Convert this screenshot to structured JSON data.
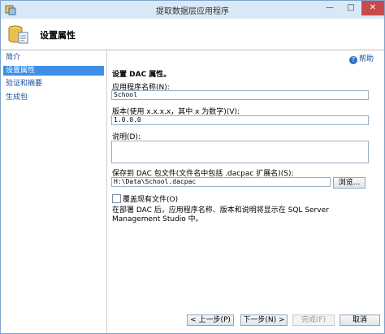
{
  "window": {
    "title": "提取数据层应用程序",
    "min_label": "—",
    "max_label": "□",
    "close_label": "✕"
  },
  "header": {
    "title": "设置属性"
  },
  "sidebar": {
    "items": [
      {
        "label": "简介",
        "active": false
      },
      {
        "label": "设置属性",
        "active": true
      },
      {
        "label": "验证和摘要",
        "active": false
      },
      {
        "label": "生成包",
        "active": false
      }
    ]
  },
  "main": {
    "help_label": "帮助",
    "section_title": "设置 DAC 属性。",
    "app_name": {
      "label": "应用程序名称(N):",
      "value": "School"
    },
    "version": {
      "label": "版本(使用 x.x.x.x，其中 x 为数字)(V):",
      "value": "1.0.0.0"
    },
    "description": {
      "label": "说明(D):",
      "value": ""
    },
    "save_to": {
      "label": "保存到 DAC 包文件(文件名中包括 .dacpac 扩展名)(S):",
      "value": "H:\\Data\\School.dacpac"
    },
    "browse_label": "浏览...",
    "overwrite_label": "覆盖现有文件(O)",
    "overwrite_checked": false,
    "note": "在部署 DAC 后，应用程序名称、版本和说明将显示在 SQL Server Management Studio 中。"
  },
  "footer": {
    "prev": "< 上一步(P)",
    "next": "下一步(N) >",
    "finish": "完成(F)",
    "cancel": "取消"
  }
}
